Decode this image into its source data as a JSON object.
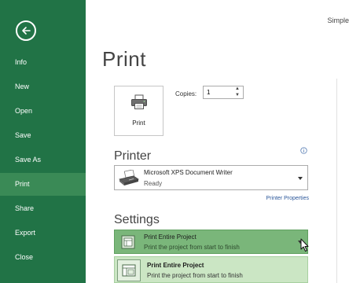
{
  "window": {
    "title": "Simple"
  },
  "sidebar": {
    "back_icon": "back-arrow-icon",
    "items": [
      {
        "label": "Info"
      },
      {
        "label": "New"
      },
      {
        "label": "Open"
      },
      {
        "label": "Save"
      },
      {
        "label": "Save As"
      },
      {
        "label": "Print",
        "active": true
      },
      {
        "label": "Share"
      },
      {
        "label": "Export"
      },
      {
        "label": "Close"
      }
    ],
    "colors": {
      "background": "#217346",
      "active": "#3a8a56"
    }
  },
  "main": {
    "title": "Print",
    "print_button": {
      "label": "Print",
      "icon": "printer-icon"
    },
    "copies": {
      "label": "Copies:",
      "value": "1"
    },
    "printer_section": {
      "title": "Printer",
      "info_icon": "info-icon",
      "selected_printer": {
        "name": "Microsoft XPS Document Writer",
        "status": "Ready",
        "icon": "xps-printer-icon"
      },
      "properties_link": "Printer Properties"
    },
    "settings_section": {
      "title": "Settings",
      "selected": {
        "title": "Print Entire Project",
        "description": "Print the project from start to finish",
        "icon": "document-icon"
      },
      "options": [
        {
          "title": "Print Entire Project",
          "description": "Print the project from start to finish",
          "icon": "document-icon"
        }
      ],
      "colors": {
        "selected_bg": "#7ab67a",
        "option_bg": "#cbe6c4"
      }
    }
  }
}
